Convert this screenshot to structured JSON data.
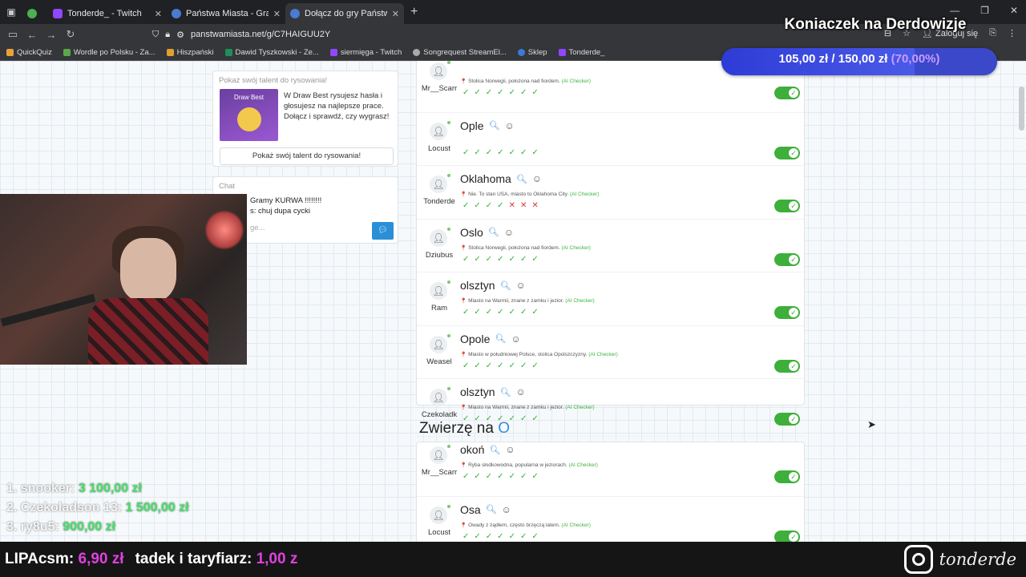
{
  "browser": {
    "tabs": [
      {
        "label": "",
        "color": "#4caf50"
      },
      {
        "label": "Tonderde_ - Twitch",
        "color": "#9146ff"
      },
      {
        "label": "Państwa Miasta - Gra online",
        "color": "#4a7ad1"
      },
      {
        "label": "Dołącz do gry Państwa Miasta",
        "color": "#4a7ad1"
      }
    ],
    "url": "panstwamiasta.net/g/C7HAIGUU2Y",
    "login": "Zaloguj się",
    "bookmarks": [
      "QuickQuiz",
      "Wordle po Polsku - Za...",
      "Hiszpański",
      "Dawid Tyszkowski - Ze...",
      "siermięga - Twitch",
      "Songrequest StreamEl...",
      "Sklep",
      "Tonderde_"
    ]
  },
  "promo": {
    "header": "Pokaż swój talent do rysowania!",
    "image_label": "Draw Best",
    "text": "W Draw Best rysujesz hasła i głosujesz na najlepsze prace. Dołącz i sprawdź, czy wygrasz!",
    "button": "Pokaż swój talent do rysowania!"
  },
  "chat": {
    "header": "Chat",
    "messages": [
      "Gramy KURWA !!!!!!!!",
      "s: chuj dupa cycki"
    ],
    "placeholder": "ge..."
  },
  "answers": [
    {
      "user": "Mr__Scarr",
      "word": "",
      "desc": "Stolica Norwegii, położona nad fiordem.",
      "votes": [
        "ok",
        "ok",
        "ok",
        "ok",
        "ok",
        "ok",
        "ok"
      ]
    },
    {
      "user": "Locust",
      "word": "Ople",
      "desc": "",
      "votes": [
        "ok",
        "ok",
        "ok",
        "ok",
        "ok",
        "ok",
        "ok"
      ]
    },
    {
      "user": "Tonderde",
      "word": "Oklahoma",
      "desc": "Nie. To stan USA, miasto to Oklahoma City.",
      "votes": [
        "ok",
        "ok",
        "ok",
        "ok",
        "no",
        "no",
        "no"
      ]
    },
    {
      "user": "Dziubus",
      "word": "Oslo",
      "desc": "Stolica Norwegii, położona nad fiordem.",
      "votes": [
        "ok",
        "ok",
        "ok",
        "ok",
        "ok",
        "ok",
        "ok"
      ]
    },
    {
      "user": "Ram",
      "word": "olsztyn",
      "desc": "Miasto na Warmii, znane z zamku i jezior.",
      "votes": [
        "ok",
        "ok",
        "ok",
        "ok",
        "ok",
        "ok",
        "ok"
      ]
    },
    {
      "user": "Weasel",
      "word": "Opole",
      "desc": "Miasto w południowej Polsce, stolica Opolszczyzny.",
      "votes": [
        "ok",
        "ok",
        "ok",
        "ok",
        "ok",
        "ok",
        "ok"
      ]
    },
    {
      "user": "Czekoladk",
      "word": "olsztyn",
      "desc": "Miasto na Warmii, znane z zamku i jezior.",
      "votes": [
        "ok",
        "ok",
        "ok",
        "ok",
        "ok",
        "ok",
        "ok"
      ]
    }
  ],
  "ai_tag": "(AI Checker)",
  "category": {
    "title": "Zwierzę na",
    "letter": "O"
  },
  "answers2": [
    {
      "user": "Mr__Scarr",
      "word": "okoń",
      "desc": "Ryba słodkowodna, popularna w jeziorach.",
      "votes": [
        "ok",
        "ok",
        "ok",
        "ok",
        "ok",
        "ok",
        "ok"
      ]
    },
    {
      "user": "Locust",
      "word": "Osa",
      "desc": "Owady z żądłem, często brzęczą latem.",
      "votes": [
        "ok",
        "ok",
        "ok",
        "ok",
        "ok",
        "ok",
        "ok"
      ]
    }
  ],
  "overlay": {
    "goal_title": "Koniaczek na Derdowizje",
    "goal_current": "105,00 zł",
    "goal_sep": "/",
    "goal_target": "150,00 zł",
    "goal_pct": "(70,00%)",
    "goal_fraction": 0.7,
    "leaderboard": [
      {
        "name": "1. snooker:",
        "amount": "3 100,00 zł"
      },
      {
        "name": "2. Czekoladson 13:",
        "amount": "1 500,00 zł"
      },
      {
        "name": "3. ry8u5:",
        "amount": "900,00 zł"
      }
    ],
    "ticker": [
      {
        "name": "LIPAcsm:",
        "amount": "6,90 zł"
      },
      {
        "name": "tadek i taryfiarz:",
        "amount": "1,00 z"
      }
    ],
    "instagram": "tonderde"
  }
}
